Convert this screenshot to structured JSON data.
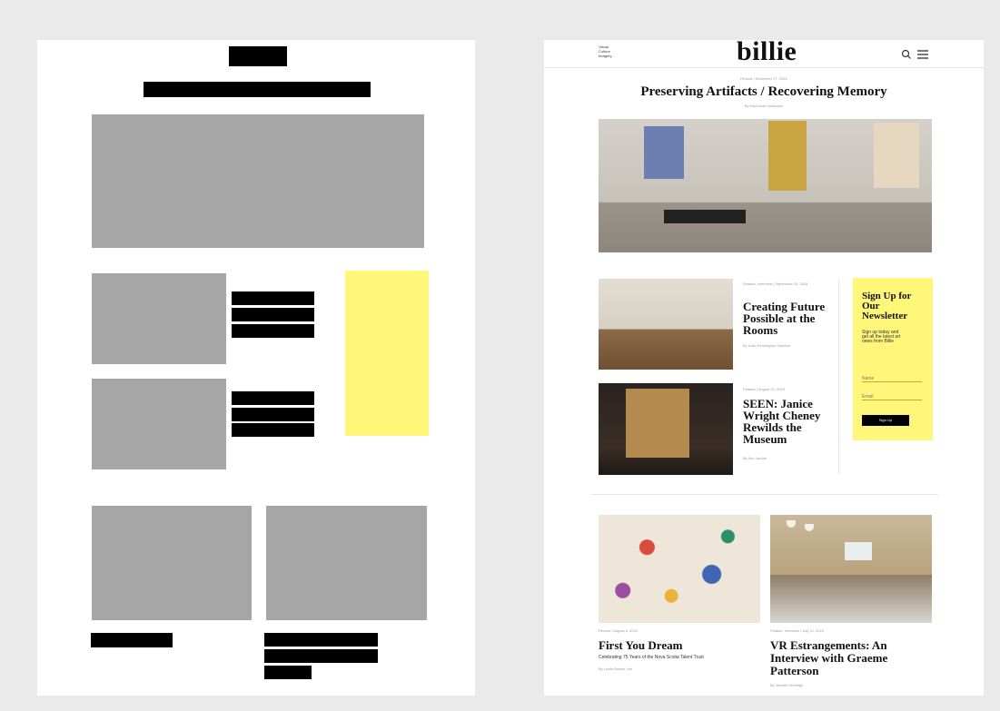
{
  "header": {
    "visual_culture": "Visual\nCulture\nImagery",
    "logo": "billie",
    "search_icon": "search-icon",
    "menu_icon": "menu-icon"
  },
  "hero": {
    "kicker": "Review | December 17, 2024",
    "title": "Preserving Artifacts / Recovering Memory",
    "byline": "By Elsa Morin Anderson"
  },
  "articles": [
    {
      "kicker": "Feature, Interview | September 20, 2024",
      "title": "Creating Future Possible at the Rooms",
      "byline": "By Leah Pennington Sanders"
    },
    {
      "kicker": "Feature | August 22, 2024",
      "title": "SEEN: Janice Wright Cheney Rewilds the Museum",
      "byline": "By Ann Jordan"
    }
  ],
  "newsletter": {
    "title": "Sign Up for Our Newsletter",
    "body": "Sign up today and get all the latest art news from Billie",
    "name_placeholder": "Name",
    "email_placeholder": "Email",
    "button": "Sign Up"
  },
  "bottom": [
    {
      "kicker": "Review | August 6, 2024",
      "title": "First You Dream",
      "tagline": "Celebrating 75 Years of the Nova Scotia Talent Trust",
      "byline": "By Lizzie Bowler Lee"
    },
    {
      "kicker": "Feature, Interview | July 12, 2024",
      "title": "VR Estrangements: An Interview with Graeme Patterson",
      "tagline": "",
      "byline": "By Jennifer McVeigh"
    }
  ],
  "colors": {
    "accent_yellow": "#fff67a",
    "placeholder_gray": "#a6a6a6",
    "background": "#eaeaea"
  }
}
